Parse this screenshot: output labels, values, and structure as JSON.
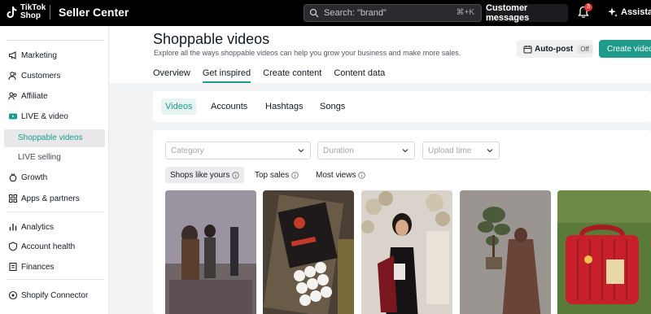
{
  "topbar": {
    "logo_text": "TikTok Shop",
    "app_title": "Seller Center",
    "search_placeholder": "Search: \"brand\"",
    "search_shortcut": "⌘+K",
    "customer_messages": "Customer messages",
    "notification_count": "3",
    "assistant_label": "Assistant"
  },
  "sidebar": {
    "items": [
      {
        "label": "Marketing",
        "icon": "megaphone-icon"
      },
      {
        "label": "Customers",
        "icon": "customers-icon"
      },
      {
        "label": "Affiliate",
        "icon": "affiliate-icon"
      },
      {
        "label": "LIVE & video",
        "icon": "live-video-icon"
      },
      {
        "label": "Shoppable videos",
        "icon": ""
      },
      {
        "label": "LIVE selling",
        "icon": ""
      },
      {
        "label": "Growth",
        "icon": "growth-icon"
      },
      {
        "label": "Apps & partners",
        "icon": "apps-icon"
      },
      {
        "label": "Analytics",
        "icon": "analytics-icon"
      },
      {
        "label": "Account health",
        "icon": "account-health-icon"
      },
      {
        "label": "Finances",
        "icon": "finances-icon"
      },
      {
        "label": "Shopify Connector",
        "icon": "shopify-connector-icon"
      }
    ],
    "active_color": "#1a9c8c"
  },
  "page": {
    "title": "Shoppable videos",
    "subtitle": "Explore all the ways shoppable videos can help you grow your business and make more sales.",
    "auto_post_label": "Auto-post",
    "auto_post_state": "Off",
    "create_video_label": "Create video",
    "tabs": [
      "Overview",
      "Get inspired",
      "Create content",
      "Content data"
    ],
    "active_tab": "Get inspired"
  },
  "subtabs": {
    "items": [
      "Videos",
      "Accounts",
      "Hashtags",
      "Songs"
    ],
    "active": "Videos"
  },
  "filters": {
    "category_placeholder": "Category",
    "duration_placeholder": "Duration",
    "upload_time_placeholder": "Upload time"
  },
  "sort_pills": {
    "items": [
      "Shops like yours",
      "Top sales",
      "Most views"
    ],
    "active": "Shops like yours"
  },
  "colors": {
    "accent": "#1f9a8b",
    "topbar": "#000000"
  }
}
